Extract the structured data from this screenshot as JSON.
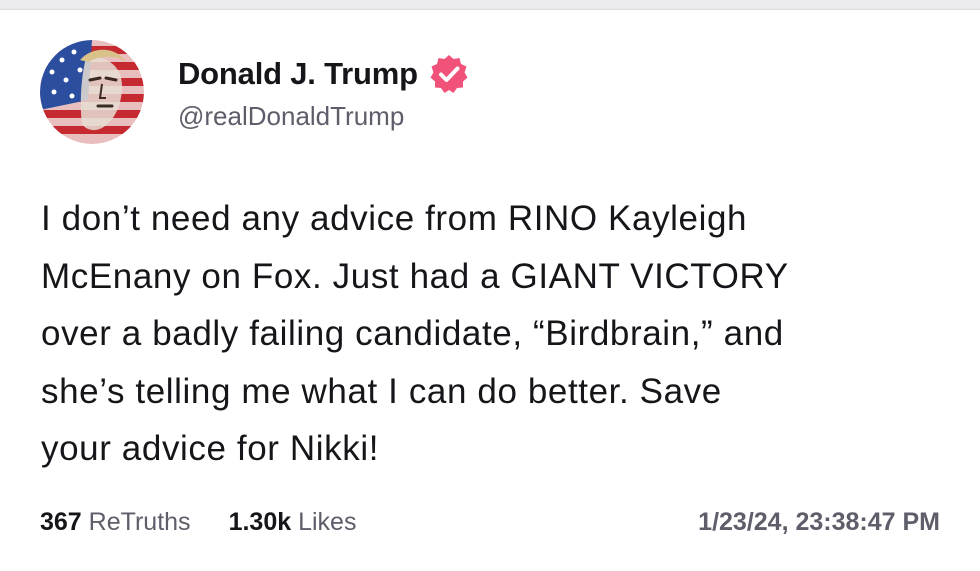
{
  "post": {
    "author": {
      "display_name": "Donald J. Trump",
      "handle": "@realDonaldTrump",
      "verified": true,
      "avatar_icon": "flag-portrait-avatar",
      "verified_icon": "verified-badge-icon"
    },
    "body_lines": [
      "I don’t need any advice from RINO Kayleigh",
      "McEnany on Fox. Just had a GIANT VICTORY",
      "over a badly failing candidate, “Birdbrain,” and",
      "she’s telling me what I can do better. Save",
      "your advice for Nikki!"
    ],
    "stats": {
      "retruths_count": "367",
      "retruths_label": "ReTruths",
      "likes_count": "1.30k",
      "likes_label": "Likes"
    },
    "timestamp": "1/23/24, 23:38:47 PM"
  },
  "colors": {
    "verified_badge": "#f0527a",
    "text_primary": "#16161a",
    "text_secondary": "#5e5e6a"
  }
}
